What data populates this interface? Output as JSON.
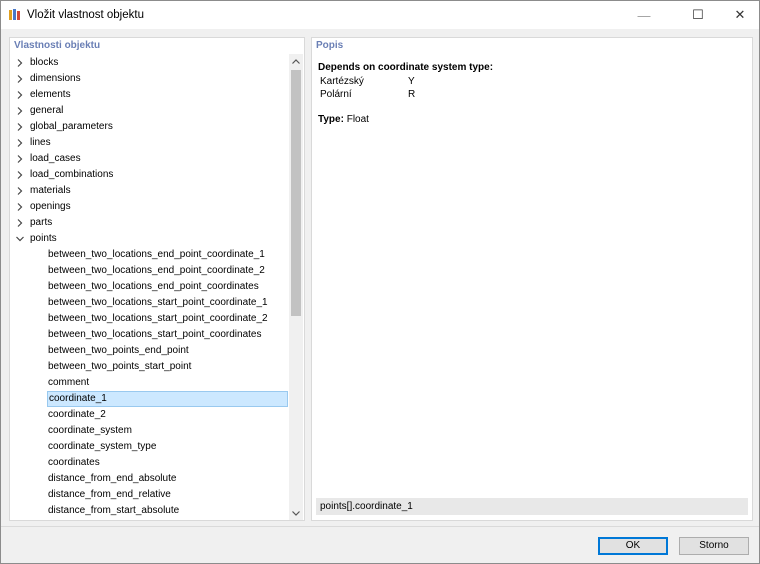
{
  "window": {
    "title": "Vložit vlastnost objektu",
    "controls": {
      "minimize": "—",
      "maximize": "☐",
      "close": "✕"
    }
  },
  "left_panel": {
    "header": "Vlastnosti objektu",
    "tree": [
      {
        "label": "blocks",
        "expanded": false,
        "level": 0
      },
      {
        "label": "dimensions",
        "expanded": false,
        "level": 0
      },
      {
        "label": "elements",
        "expanded": false,
        "level": 0
      },
      {
        "label": "general",
        "expanded": false,
        "level": 0
      },
      {
        "label": "global_parameters",
        "expanded": false,
        "level": 0
      },
      {
        "label": "lines",
        "expanded": false,
        "level": 0
      },
      {
        "label": "load_cases",
        "expanded": false,
        "level": 0
      },
      {
        "label": "load_combinations",
        "expanded": false,
        "level": 0
      },
      {
        "label": "materials",
        "expanded": false,
        "level": 0
      },
      {
        "label": "openings",
        "expanded": false,
        "level": 0
      },
      {
        "label": "parts",
        "expanded": false,
        "level": 0
      },
      {
        "label": "points",
        "expanded": true,
        "level": 0
      },
      {
        "label": "between_two_locations_end_point_coordinate_1",
        "level": 1
      },
      {
        "label": "between_two_locations_end_point_coordinate_2",
        "level": 1
      },
      {
        "label": "between_two_locations_end_point_coordinates",
        "level": 1
      },
      {
        "label": "between_two_locations_start_point_coordinate_1",
        "level": 1
      },
      {
        "label": "between_two_locations_start_point_coordinate_2",
        "level": 1
      },
      {
        "label": "between_two_locations_start_point_coordinates",
        "level": 1
      },
      {
        "label": "between_two_points_end_point",
        "level": 1
      },
      {
        "label": "between_two_points_start_point",
        "level": 1
      },
      {
        "label": "comment",
        "level": 1
      },
      {
        "label": "coordinate_1",
        "level": 1,
        "selected": true
      },
      {
        "label": "coordinate_2",
        "level": 1
      },
      {
        "label": "coordinate_system",
        "level": 1
      },
      {
        "label": "coordinate_system_type",
        "level": 1
      },
      {
        "label": "coordinates",
        "level": 1
      },
      {
        "label": "distance_from_end_absolute",
        "level": 1
      },
      {
        "label": "distance_from_end_relative",
        "level": 1
      },
      {
        "label": "distance_from_start_absolute",
        "level": 1
      }
    ]
  },
  "right_panel": {
    "header": "Popis",
    "description_title": "Depends on coordinate system type:",
    "rows": [
      {
        "key": "Kartézský",
        "value": "Y"
      },
      {
        "key": "Polární",
        "value": "R"
      }
    ],
    "type_label": "Type:",
    "type_value": "Float",
    "path": "points[].coordinate_1"
  },
  "buttons": {
    "ok": "OK",
    "cancel": "Storno"
  },
  "colors": {
    "header_text": "#6a7fb5",
    "selection_bg": "#cce8ff",
    "ok_border": "#0078d7"
  }
}
